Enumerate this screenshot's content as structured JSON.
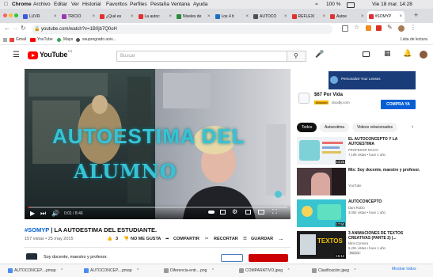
{
  "menubar": {
    "app": "Chrome",
    "items": [
      "Archivo",
      "Editar",
      "Ver",
      "Historial",
      "Favoritos",
      "Perfiles",
      "Pestaña",
      "Ventana",
      "Ayuda"
    ],
    "battery": "100 %",
    "clock": "Vie 18 mar. 14:28"
  },
  "tabs": [
    {
      "label": "LUVR",
      "color": "#3b5bdb"
    },
    {
      "label": "TRICIO",
      "color": "#9c36b5"
    },
    {
      "label": "¿Qué es",
      "color": "#e03131"
    },
    {
      "label": "La autoc",
      "color": "#e03131"
    },
    {
      "label": "Niveles de",
      "color": "#2b8a3e"
    },
    {
      "label": "Los 4 ti",
      "color": "#1971c2"
    },
    {
      "label": "AUTOCO",
      "color": "#495057"
    },
    {
      "label": "REFLEXI",
      "color": "#e03131"
    },
    {
      "label": "Autoe",
      "color": "#e03131"
    },
    {
      "label": "#SOMYP",
      "color": "#e03131"
    }
  ],
  "omnibox": {
    "url": "youtube.com/watch?v=1B0jb7Q0oH"
  },
  "bookmarks": {
    "items": [
      "Gmail",
      "YouTube",
      "Maps",
      "seupregrado.univ..."
    ],
    "reading_list": "Lista de lectura"
  },
  "youtube": {
    "logo_text": "YouTube",
    "country": "ES",
    "search_placeholder": "Buscar"
  },
  "video": {
    "overlay_lines": [
      "AUTOESTIMA DEL",
      "ALUMNO"
    ],
    "progress": 0.006,
    "time": "0:01 / 8:46"
  },
  "info": {
    "title_tag": "#SOMYP",
    "title_rest": " | LA AUTOESTIMA DEL ESTUDIANTE.",
    "meta": "157 vistas • 25 may 2015",
    "likes": "3",
    "dislike": "NO ME GUSTA",
    "share": "COMPARTIR",
    "clip": "RECORTAR",
    "save": "GUARDAR",
    "more": "...",
    "channel": "Soy docente, maestro y profesor."
  },
  "ad": {
    "banner_text": "Personalize Your Lenses",
    "price": "$67 Por Vida",
    "badge": "Anuncio",
    "domain": "doodly.com",
    "cta": "COMPRA YA"
  },
  "chips": [
    "Todos",
    "Autoestima",
    "Videos relacionados"
  ],
  "recommended": [
    {
      "title": "EL AUTOCONCEPTO Y LA AUTOESTIMA",
      "channel": "PROFESOR NACHI",
      "meta": "7,199 vistas • hace 1 año",
      "duration": "14:29"
    },
    {
      "title": "Mix: Soy docente, maestro y profesor.",
      "channel": "YouTube",
      "meta": "",
      "duration": ""
    },
    {
      "title": "AUTOCONCEPTO",
      "channel": "Dani Rubio",
      "meta": "3,092 vistas • hace 1 año",
      "duration": "17:50"
    },
    {
      "title": "3 ANIMACIONES DE TEXTOS CREATIVAS (PARTE 2) |...",
      "channel": "Mimi Cornera",
      "meta": "5,291 vistas • hace 1 año",
      "duration": "15:12",
      "badge": "Nuevo"
    }
  ],
  "downloads": [
    "AUTOCONCEP....pmap",
    "AUTOCONCEP....pmap",
    "Diferencia-entr....png",
    "COMPARATIVO.jpeg",
    "Clasificación.jpeg"
  ],
  "downloads_show_all": "Mostrar todos",
  "colors": {
    "youtube_red": "#ff0000",
    "link_blue": "#065fd4",
    "ad_navy": "#1a3d7a"
  }
}
